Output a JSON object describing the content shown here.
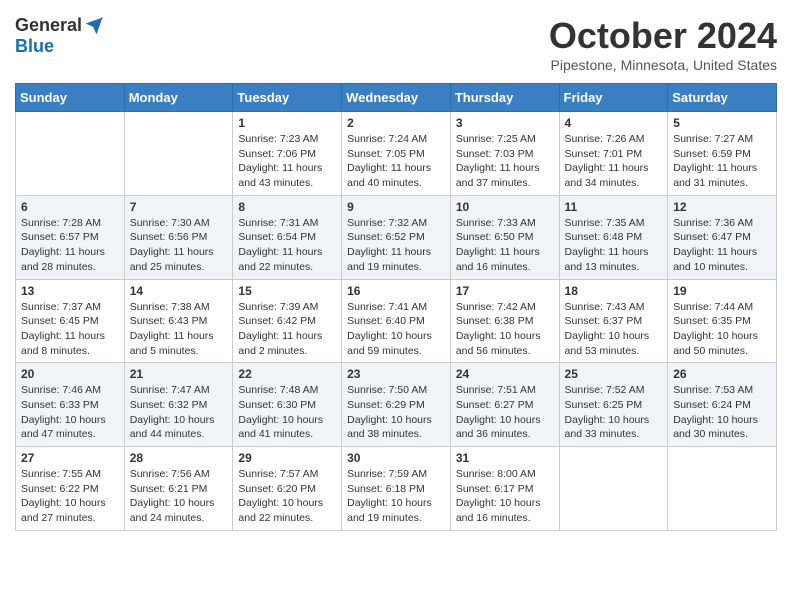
{
  "logo": {
    "general": "General",
    "blue": "Blue"
  },
  "title": "October 2024",
  "location": "Pipestone, Minnesota, United States",
  "days_of_week": [
    "Sunday",
    "Monday",
    "Tuesday",
    "Wednesday",
    "Thursday",
    "Friday",
    "Saturday"
  ],
  "weeks": [
    [
      {
        "day": "",
        "info": ""
      },
      {
        "day": "",
        "info": ""
      },
      {
        "day": "1",
        "info": "Sunrise: 7:23 AM\nSunset: 7:06 PM\nDaylight: 11 hours and 43 minutes."
      },
      {
        "day": "2",
        "info": "Sunrise: 7:24 AM\nSunset: 7:05 PM\nDaylight: 11 hours and 40 minutes."
      },
      {
        "day": "3",
        "info": "Sunrise: 7:25 AM\nSunset: 7:03 PM\nDaylight: 11 hours and 37 minutes."
      },
      {
        "day": "4",
        "info": "Sunrise: 7:26 AM\nSunset: 7:01 PM\nDaylight: 11 hours and 34 minutes."
      },
      {
        "day": "5",
        "info": "Sunrise: 7:27 AM\nSunset: 6:59 PM\nDaylight: 11 hours and 31 minutes."
      }
    ],
    [
      {
        "day": "6",
        "info": "Sunrise: 7:28 AM\nSunset: 6:57 PM\nDaylight: 11 hours and 28 minutes."
      },
      {
        "day": "7",
        "info": "Sunrise: 7:30 AM\nSunset: 6:56 PM\nDaylight: 11 hours and 25 minutes."
      },
      {
        "day": "8",
        "info": "Sunrise: 7:31 AM\nSunset: 6:54 PM\nDaylight: 11 hours and 22 minutes."
      },
      {
        "day": "9",
        "info": "Sunrise: 7:32 AM\nSunset: 6:52 PM\nDaylight: 11 hours and 19 minutes."
      },
      {
        "day": "10",
        "info": "Sunrise: 7:33 AM\nSunset: 6:50 PM\nDaylight: 11 hours and 16 minutes."
      },
      {
        "day": "11",
        "info": "Sunrise: 7:35 AM\nSunset: 6:48 PM\nDaylight: 11 hours and 13 minutes."
      },
      {
        "day": "12",
        "info": "Sunrise: 7:36 AM\nSunset: 6:47 PM\nDaylight: 11 hours and 10 minutes."
      }
    ],
    [
      {
        "day": "13",
        "info": "Sunrise: 7:37 AM\nSunset: 6:45 PM\nDaylight: 11 hours and 8 minutes."
      },
      {
        "day": "14",
        "info": "Sunrise: 7:38 AM\nSunset: 6:43 PM\nDaylight: 11 hours and 5 minutes."
      },
      {
        "day": "15",
        "info": "Sunrise: 7:39 AM\nSunset: 6:42 PM\nDaylight: 11 hours and 2 minutes."
      },
      {
        "day": "16",
        "info": "Sunrise: 7:41 AM\nSunset: 6:40 PM\nDaylight: 10 hours and 59 minutes."
      },
      {
        "day": "17",
        "info": "Sunrise: 7:42 AM\nSunset: 6:38 PM\nDaylight: 10 hours and 56 minutes."
      },
      {
        "day": "18",
        "info": "Sunrise: 7:43 AM\nSunset: 6:37 PM\nDaylight: 10 hours and 53 minutes."
      },
      {
        "day": "19",
        "info": "Sunrise: 7:44 AM\nSunset: 6:35 PM\nDaylight: 10 hours and 50 minutes."
      }
    ],
    [
      {
        "day": "20",
        "info": "Sunrise: 7:46 AM\nSunset: 6:33 PM\nDaylight: 10 hours and 47 minutes."
      },
      {
        "day": "21",
        "info": "Sunrise: 7:47 AM\nSunset: 6:32 PM\nDaylight: 10 hours and 44 minutes."
      },
      {
        "day": "22",
        "info": "Sunrise: 7:48 AM\nSunset: 6:30 PM\nDaylight: 10 hours and 41 minutes."
      },
      {
        "day": "23",
        "info": "Sunrise: 7:50 AM\nSunset: 6:29 PM\nDaylight: 10 hours and 38 minutes."
      },
      {
        "day": "24",
        "info": "Sunrise: 7:51 AM\nSunset: 6:27 PM\nDaylight: 10 hours and 36 minutes."
      },
      {
        "day": "25",
        "info": "Sunrise: 7:52 AM\nSunset: 6:25 PM\nDaylight: 10 hours and 33 minutes."
      },
      {
        "day": "26",
        "info": "Sunrise: 7:53 AM\nSunset: 6:24 PM\nDaylight: 10 hours and 30 minutes."
      }
    ],
    [
      {
        "day": "27",
        "info": "Sunrise: 7:55 AM\nSunset: 6:22 PM\nDaylight: 10 hours and 27 minutes."
      },
      {
        "day": "28",
        "info": "Sunrise: 7:56 AM\nSunset: 6:21 PM\nDaylight: 10 hours and 24 minutes."
      },
      {
        "day": "29",
        "info": "Sunrise: 7:57 AM\nSunset: 6:20 PM\nDaylight: 10 hours and 22 minutes."
      },
      {
        "day": "30",
        "info": "Sunrise: 7:59 AM\nSunset: 6:18 PM\nDaylight: 10 hours and 19 minutes."
      },
      {
        "day": "31",
        "info": "Sunrise: 8:00 AM\nSunset: 6:17 PM\nDaylight: 10 hours and 16 minutes."
      },
      {
        "day": "",
        "info": ""
      },
      {
        "day": "",
        "info": ""
      }
    ]
  ]
}
